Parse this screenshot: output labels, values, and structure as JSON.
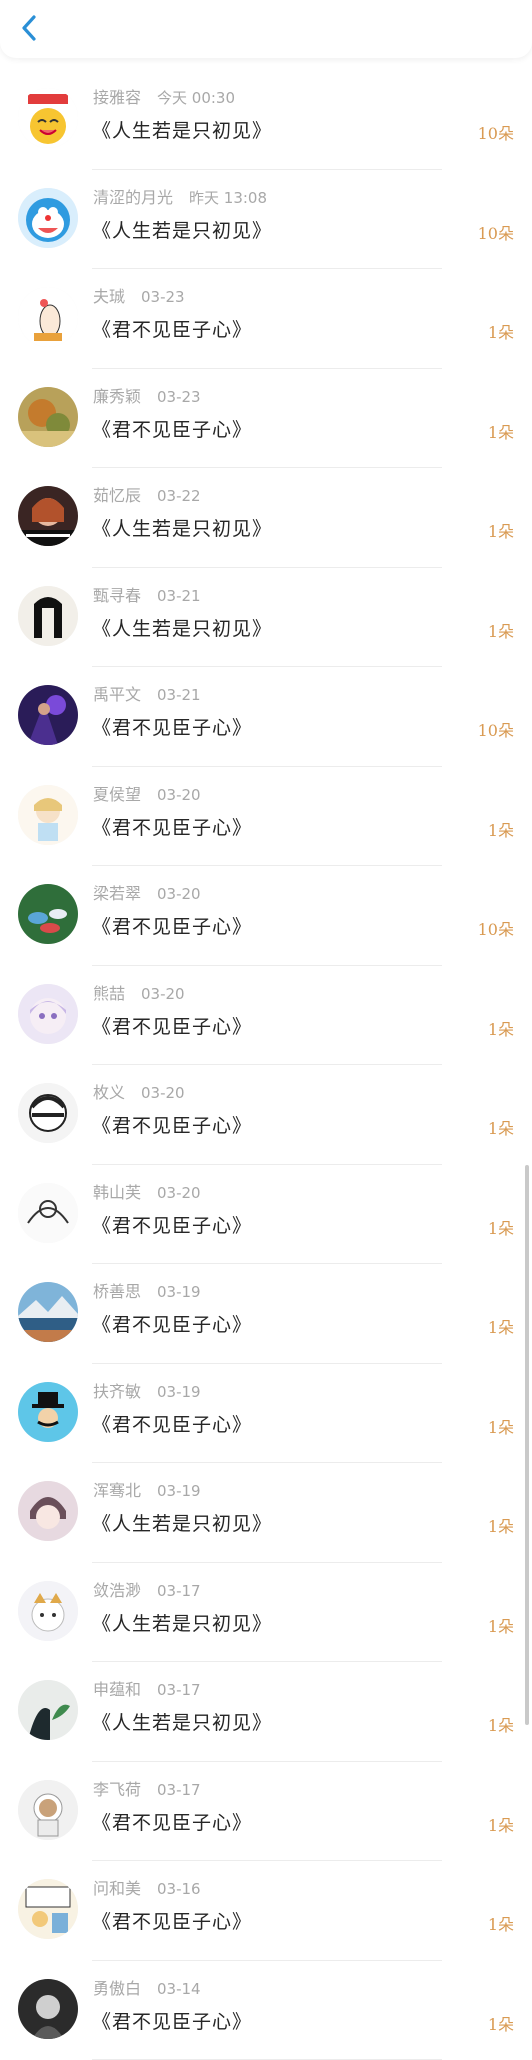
{
  "header": {
    "back_icon": "chevron-left-icon",
    "accent": "#2a8fd6"
  },
  "list": {
    "count_color": "#d99a52",
    "rows": [
      {
        "name": "接雅容",
        "time": "今天 00:30",
        "title": "《人生若是只初见》",
        "count": "10朵",
        "avatar": "cat-laughing"
      },
      {
        "name": "清涩的月光",
        "time": "昨天 13:08",
        "title": "《人生若是只初见》",
        "count": "10朵",
        "avatar": "doraemon"
      },
      {
        "name": "夫珹",
        "time": "03-23",
        "title": "《君不见臣子心》",
        "count": "1朵",
        "avatar": "cartoon-doodle"
      },
      {
        "name": "廉秀颖",
        "time": "03-23",
        "title": "《君不见臣子心》",
        "count": "1朵",
        "avatar": "autumn-photo"
      },
      {
        "name": "茹忆辰",
        "time": "03-22",
        "title": "《人生若是只初见》",
        "count": "1朵",
        "avatar": "girl-photo"
      },
      {
        "name": "甄寻春",
        "time": "03-21",
        "title": "《人生若是只初见》",
        "count": "1朵",
        "avatar": "black-hair"
      },
      {
        "name": "禹平文",
        "time": "03-21",
        "title": "《君不见臣子心》",
        "count": "10朵",
        "avatar": "night-purple"
      },
      {
        "name": "夏侯望",
        "time": "03-20",
        "title": "《君不见臣子心》",
        "count": "1朵",
        "avatar": "sketch-girl"
      },
      {
        "name": "梁若翠",
        "time": "03-20",
        "title": "《君不见臣子心》",
        "count": "10朵",
        "avatar": "tea-cups"
      },
      {
        "name": "熊喆",
        "time": "03-20",
        "title": "《君不见臣子心》",
        "count": "1朵",
        "avatar": "anime-girl"
      },
      {
        "name": "枚义",
        "time": "03-20",
        "title": "《君不见臣子心》",
        "count": "1朵",
        "avatar": "manga-bw"
      },
      {
        "name": "韩山芙",
        "time": "03-20",
        "title": "《君不见臣子心》",
        "count": "1朵",
        "avatar": "line-art"
      },
      {
        "name": "桥善思",
        "time": "03-19",
        "title": "《君不见臣子心》",
        "count": "1朵",
        "avatar": "lake-mountain"
      },
      {
        "name": "扶齐敏",
        "time": "03-19",
        "title": "《君不见臣子心》",
        "count": "1朵",
        "avatar": "top-hat"
      },
      {
        "name": "浑骞北",
        "time": "03-19",
        "title": "《人生若是只初见》",
        "count": "1朵",
        "avatar": "anime-boy"
      },
      {
        "name": "敛浩渺",
        "time": "03-17",
        "title": "《人生若是只初见》",
        "count": "1朵",
        "avatar": "fox-cartoon"
      },
      {
        "name": "申蕴和",
        "time": "03-17",
        "title": "《人生若是只初见》",
        "count": "1朵",
        "avatar": "plant-dark"
      },
      {
        "name": "李飞荷",
        "time": "03-17",
        "title": "《君不见臣子心》",
        "count": "1朵",
        "avatar": "astronaut"
      },
      {
        "name": "问和美",
        "time": "03-16",
        "title": "《君不见臣子心》",
        "count": "1朵",
        "avatar": "comic-panel"
      },
      {
        "name": "勇傲白",
        "time": "03-14",
        "title": "《君不见臣子心》",
        "count": "1朵",
        "avatar": "bw-portrait"
      }
    ]
  }
}
